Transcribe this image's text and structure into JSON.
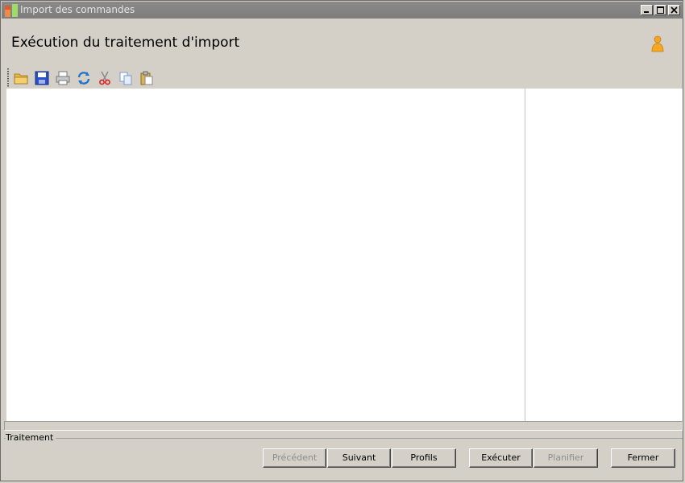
{
  "window": {
    "title": "Import des commandes"
  },
  "header": {
    "title": "Exécution du traitement d'import"
  },
  "toolbar": {
    "items": [
      "open-folder-icon",
      "save-icon",
      "print-icon",
      "refresh-icon",
      "cut-icon",
      "copy-icon",
      "paste-icon"
    ]
  },
  "group": {
    "label": "Traitement"
  },
  "buttons": {
    "precedent": "Précédent",
    "suivant": "Suivant",
    "profils": "Profils",
    "executer": "Exécuter",
    "planifier": "Planifier",
    "fermer": "Fermer"
  },
  "colors": {
    "titlebar": "#7d7d7d",
    "window_bg": "#d4d0c8",
    "content_bg": "#ffffff",
    "disabled_text": "#8e8e8e"
  }
}
